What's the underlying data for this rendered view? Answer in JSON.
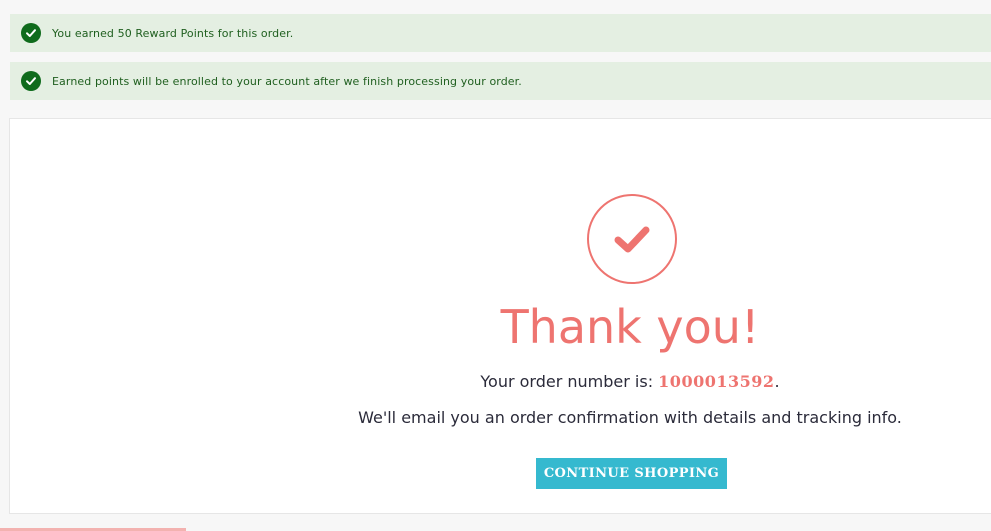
{
  "notices": [
    {
      "text": "You earned 50 Reward Points for this order.",
      "icon": "check-circle-icon"
    },
    {
      "text": "Earned points will be enrolled to your account after we finish processing your order.",
      "icon": "check-circle-icon"
    }
  ],
  "confirmation": {
    "icon": "checkmark-circle-icon",
    "heading": "Thank you!",
    "order_prefix": "Your order number is: ",
    "order_number": "1000013592",
    "order_suffix": ".",
    "email_text": "We'll email you an order confirmation with details and tracking info.",
    "continue_label": "CONTINUE SHOPPING"
  },
  "colors": {
    "notice_bg": "#e4efe2",
    "notice_icon": "#0f6b1c",
    "accent": "#ee7470",
    "button": "#35b9cf"
  }
}
